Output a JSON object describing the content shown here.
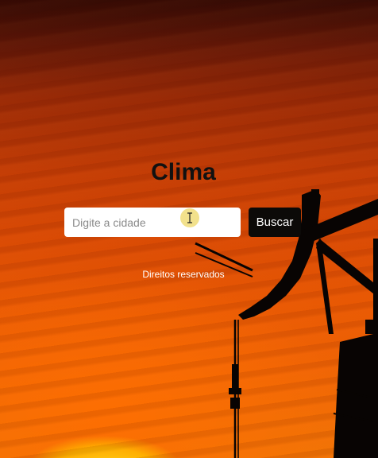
{
  "app": {
    "title": "Clima"
  },
  "search": {
    "placeholder": "Digite a cidade",
    "value": "",
    "button_label": "Buscar"
  },
  "footer": {
    "text": "Direitos reservados"
  },
  "cursor": {
    "icon": "text-cursor-icon"
  },
  "colors": {
    "sky_top": "#3a0d06",
    "sky_bottom": "#f27505",
    "sun": "#ffd21a",
    "button_bg": "#0c0a08",
    "title_text": "#111111",
    "footer_text": "#ffffff"
  }
}
